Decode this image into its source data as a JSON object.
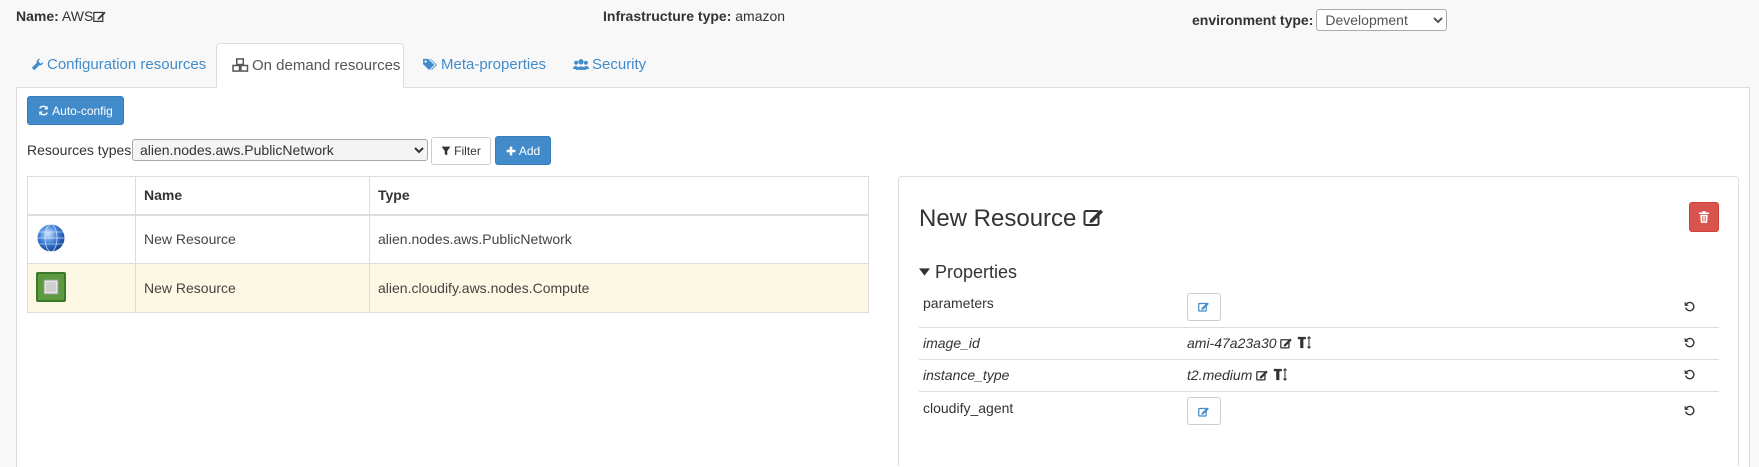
{
  "header": {
    "name_label": "Name:",
    "name_value": "AWS",
    "infra_label": "Infrastructure type:",
    "infra_value": "amazon",
    "env_label": "environment type:",
    "env_value": "Development"
  },
  "tabs": [
    {
      "label": "Configuration resources",
      "icon": "wrench-icon",
      "active": false
    },
    {
      "label": "On demand resources",
      "icon": "cubes-icon",
      "active": true
    },
    {
      "label": "Meta-properties",
      "icon": "tags-icon",
      "active": false
    },
    {
      "label": "Security",
      "icon": "users-icon",
      "active": false
    }
  ],
  "toolbar": {
    "autoconfig_label": "Auto-config",
    "resource_types_label": "Resources types:",
    "resource_type_selected": "alien.nodes.aws.PublicNetwork",
    "filter_label": "Filter",
    "add_label": "Add"
  },
  "resources_table": {
    "columns": [
      "",
      "Name",
      "Type"
    ],
    "rows": [
      {
        "icon": "globe-icon",
        "name": "New Resource",
        "type": "alien.nodes.aws.PublicNetwork",
        "selected": false
      },
      {
        "icon": "compute-chip-icon",
        "name": "New Resource",
        "type": "alien.cloudify.aws.nodes.Compute",
        "selected": true
      }
    ]
  },
  "detail": {
    "title": "New Resource",
    "properties_header": "Properties",
    "properties": [
      {
        "name": "parameters",
        "value": "",
        "kind": "complex",
        "required": true
      },
      {
        "name": "image_id",
        "value": "ami-47a23a30",
        "kind": "scalar",
        "required": false
      },
      {
        "name": "instance_type",
        "value": "t2.medium",
        "kind": "scalar",
        "required": false
      },
      {
        "name": "cloudify_agent",
        "value": "",
        "kind": "complex",
        "required": true
      }
    ]
  },
  "colors": {
    "link": "#428bca",
    "primary": "#428bca",
    "danger": "#d9534f",
    "selected_row": "#fcf8e3"
  }
}
